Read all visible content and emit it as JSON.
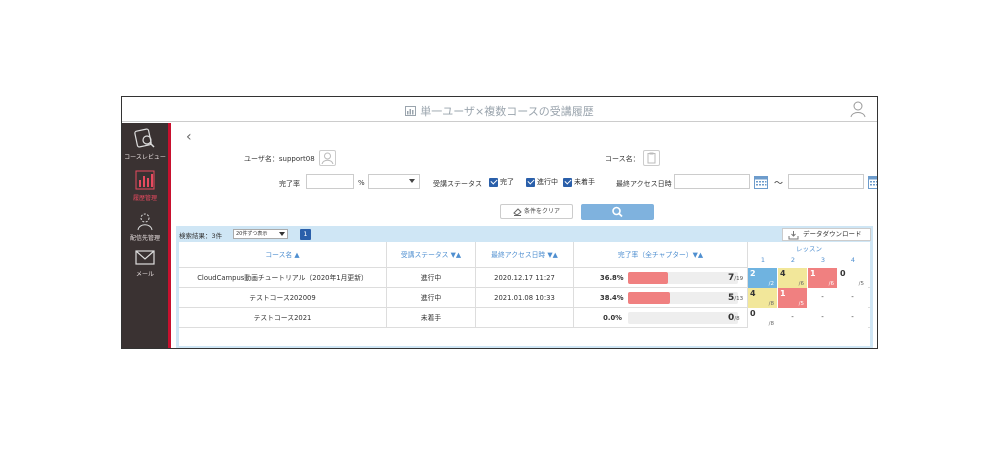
{
  "app": {
    "title": "単一ユーザ×複数コースの受講履歴"
  },
  "sidebar": {
    "items": [
      {
        "label": "コースレビュー",
        "icon": "course-review-icon"
      },
      {
        "label": "履歴管理",
        "icon": "history-chart-icon",
        "active": true
      },
      {
        "label": "配信先管理",
        "icon": "recipient-management-icon"
      },
      {
        "label": "メール",
        "icon": "mail-icon"
      }
    ]
  },
  "filters": {
    "user_label": "ユーザ名：support08",
    "course_label": "コース名：",
    "completion_label": "完了率",
    "percent_symbol": "%",
    "status_label": "受講ステータス",
    "status_options": [
      {
        "label": "完了",
        "checked": true
      },
      {
        "label": "進行中",
        "checked": true
      },
      {
        "label": "未着手",
        "checked": true
      }
    ],
    "last_access_label": "最終アクセス日時",
    "tilde": "〜",
    "clear_button": "条件をクリア"
  },
  "results": {
    "count_text": "検索結果：3件",
    "per_page": "20件ずつ表示",
    "page": "1",
    "download_button": "データダウンロード",
    "headers": {
      "course": "コース名 ▲",
      "status": "受講ステータス ▼▲",
      "last_access": "最終アクセス日時 ▼▲",
      "completion": "完了率（全チャプター）▼▲",
      "lessons": "レッスン",
      "lesson_numbers": [
        "1",
        "2",
        "3",
        "4"
      ]
    },
    "rows": [
      {
        "course": "CloudCampus動画チュートリアル（2020年1月更新）",
        "status": "進行中",
        "last_access": "2020.12.17 11:27",
        "percent": "36.8%",
        "fraction": 0.368,
        "done": "7",
        "total": "/19",
        "lessons": [
          {
            "done": "2",
            "total": "/2",
            "color": "#6fb3e0"
          },
          {
            "done": "4",
            "total": "/6",
            "color": "#f2e79a"
          },
          {
            "done": "1",
            "total": "/6",
            "color": "#f08080"
          },
          {
            "done": "0",
            "total": "/5",
            "color": "#ffffff"
          }
        ]
      },
      {
        "course": "テストコース202009",
        "status": "進行中",
        "last_access": "2021.01.08 10:33",
        "percent": "38.4%",
        "fraction": 0.384,
        "done": "5",
        "total": "/13",
        "lessons": [
          {
            "done": "4",
            "total": "/8",
            "color": "#f2e79a"
          },
          {
            "done": "1",
            "total": "/5",
            "color": "#f08080"
          },
          {
            "done": "-",
            "total": "",
            "color": "#ffffff"
          },
          {
            "done": "-",
            "total": "",
            "color": "#ffffff"
          }
        ]
      },
      {
        "course": "テストコース2021",
        "status": "未着手",
        "last_access": "",
        "percent": "0.0%",
        "fraction": 0,
        "done": "0",
        "total": "/8",
        "lessons": [
          {
            "done": "0",
            "total": "/8",
            "color": "#ffffff"
          },
          {
            "done": "-",
            "total": "",
            "color": "#ffffff"
          },
          {
            "done": "-",
            "total": "",
            "color": "#ffffff"
          },
          {
            "done": "-",
            "total": "",
            "color": "#ffffff"
          }
        ]
      }
    ]
  },
  "colors": {
    "accent": "#2a5faa",
    "search_button": "#7fb2de",
    "sidebar_bg": "#3a3232",
    "sidebar_accent": "#c8102e",
    "progress": "#f08080",
    "header_text": "#4f8fd0"
  }
}
